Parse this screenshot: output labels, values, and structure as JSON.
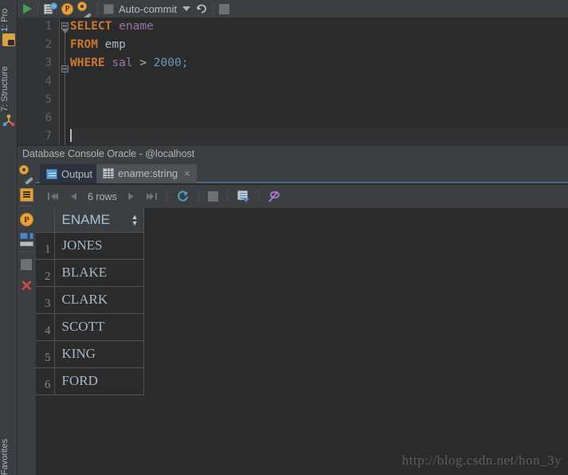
{
  "sidebar": {
    "items": [
      {
        "label": "1: Pro",
        "icon": "project-folder-icon"
      },
      {
        "label": "7: Structure",
        "icon": "structure-icon"
      },
      {
        "label": "Favorites",
        "icon": "favorites-icon"
      }
    ]
  },
  "toolbar": {
    "run_icon": "run-play-icon",
    "history_icon": "query-history-icon",
    "params_icon": "parameters-icon",
    "settings_icon": "data-source-settings-icon",
    "autocommit_label": "Auto-commit",
    "autocommit_checked": false,
    "dropdown_icon": "chevron-down-icon",
    "rollback_icon": "rollback-icon",
    "stop_icon": "stop-icon"
  },
  "editor": {
    "line_numbers": [
      "1",
      "2",
      "3",
      "4",
      "5",
      "6",
      "7"
    ],
    "current_line": 7,
    "lines": [
      {
        "n": 1,
        "tokens": [
          {
            "t": "SELECT",
            "c": "kw"
          },
          {
            "t": " ",
            "c": "op"
          },
          {
            "t": "ename",
            "c": "col"
          }
        ]
      },
      {
        "n": 2,
        "tokens": [
          {
            "t": "FROM",
            "c": "kw"
          },
          {
            "t": " ",
            "c": "op"
          },
          {
            "t": "emp",
            "c": "tbl"
          }
        ]
      },
      {
        "n": 3,
        "tokens": [
          {
            "t": "WHERE",
            "c": "kw"
          },
          {
            "t": " ",
            "c": "op"
          },
          {
            "t": "sal",
            "c": "col"
          },
          {
            "t": " > ",
            "c": "op"
          },
          {
            "t": "2000",
            "c": "num"
          },
          {
            "t": ";",
            "c": "num"
          }
        ]
      },
      {
        "n": 4,
        "tokens": []
      },
      {
        "n": 5,
        "tokens": []
      },
      {
        "n": 6,
        "tokens": []
      },
      {
        "n": 7,
        "tokens": []
      }
    ],
    "plain_text": "SELECT ename\nFROM emp\nWHERE sal > 2000;"
  },
  "console": {
    "title": "Database Console Oracle - @localhost",
    "side_icons": [
      "data-source-settings-icon",
      "table-editor-icon",
      "parameters-icon",
      "database-output-icon",
      "stop-icon",
      "close-icon"
    ],
    "tabs": [
      {
        "label": "Output",
        "icon": "output-icon",
        "active": false,
        "closable": false
      },
      {
        "label": "ename:string",
        "icon": "result-grid-icon",
        "active": true,
        "closable": true,
        "close_label": "×"
      }
    ]
  },
  "result_toolbar": {
    "first_page_icon": "first-page-icon",
    "prev_page_icon": "previous-page-icon",
    "rows_label": "6 rows",
    "next_page_icon": "next-page-icon",
    "last_page_icon": "last-page-icon",
    "reload_icon": "reload-icon",
    "stop_icon": "stop-icon",
    "export_icon": "export-data-icon",
    "pin_icon": "pin-tab-icon"
  },
  "result_grid": {
    "columns": [
      "ENAME"
    ],
    "sort_indicator": "↕",
    "row_numbers": [
      "1",
      "2",
      "3",
      "4",
      "5",
      "6"
    ],
    "rows": [
      {
        "num": "1",
        "ENAME": "JONES"
      },
      {
        "num": "2",
        "ENAME": "BLAKE"
      },
      {
        "num": "3",
        "ENAME": "CLARK"
      },
      {
        "num": "4",
        "ENAME": "SCOTT"
      },
      {
        "num": "5",
        "ENAME": "KING"
      },
      {
        "num": "6",
        "ENAME": "FORD"
      }
    ]
  },
  "watermark": {
    "text": "http://blog.csdn.net/hon_3y"
  },
  "colors": {
    "background": "#2b2b2b",
    "panel": "#3c3f41",
    "keyword": "#cc7832",
    "column": "#9876aa",
    "number": "#6897bb",
    "text": "#a9b7c6",
    "accent_blue": "#4a6a8a",
    "run_green": "#499c54",
    "close_red": "#cc4b4b",
    "reload_cyan": "#40a6c8",
    "pin_purple": "#a875c8",
    "orange_badge": "#e8a33d"
  }
}
